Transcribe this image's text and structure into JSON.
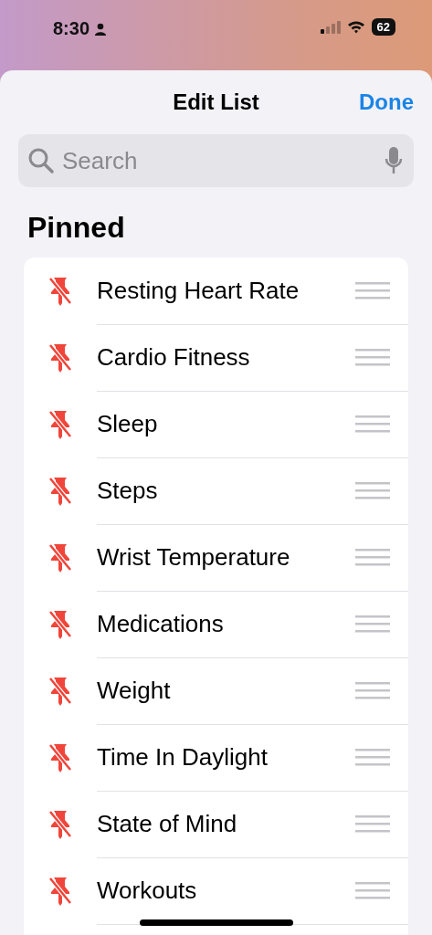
{
  "status_bar": {
    "time": "8:30",
    "battery": "62"
  },
  "header": {
    "title": "Edit List",
    "done": "Done"
  },
  "search": {
    "placeholder": "Search"
  },
  "section": {
    "title": "Pinned"
  },
  "items": [
    {
      "label": "Resting Heart Rate"
    },
    {
      "label": "Cardio Fitness"
    },
    {
      "label": "Sleep"
    },
    {
      "label": "Steps"
    },
    {
      "label": "Wrist Temperature"
    },
    {
      "label": "Medications"
    },
    {
      "label": "Weight"
    },
    {
      "label": "Time In Daylight"
    },
    {
      "label": "State of Mind"
    },
    {
      "label": "Workouts"
    }
  ]
}
